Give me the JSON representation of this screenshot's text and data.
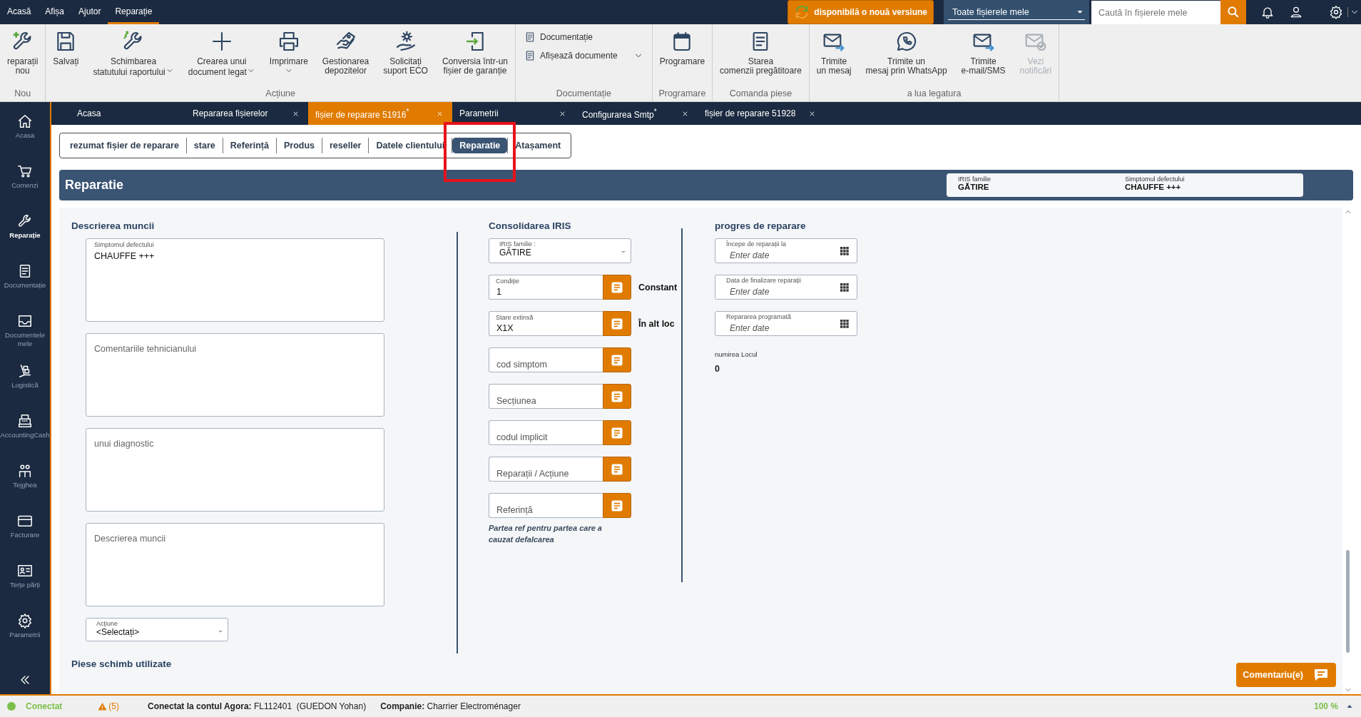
{
  "menu": [
    {
      "label": "Acasă",
      "selected": false
    },
    {
      "label": "Afișa",
      "selected": false
    },
    {
      "label": "Ajutor",
      "selected": false
    },
    {
      "label": "Reparație",
      "selected": true
    }
  ],
  "update_button": {
    "label": "disponibilă o nouă versiune"
  },
  "file_filter": {
    "value": "Toate fișierele mele"
  },
  "search": {
    "placeholder": "Caută în fișierele mele"
  },
  "ribbon": {
    "groups": [
      {
        "label": "Nou",
        "items": [
          {
            "kind": "large",
            "lines": [
              "reparații",
              "nou"
            ],
            "dropdown": false,
            "disabled": false
          }
        ]
      },
      {
        "label": "Acțiune",
        "items": [
          {
            "kind": "large",
            "lines": [
              "Salvați"
            ],
            "dropdown": false,
            "disabled": false
          },
          {
            "kind": "large",
            "lines": [
              "Schimbarea",
              "statutului raportului"
            ],
            "dropdown": true,
            "disabled": false
          },
          {
            "kind": "large",
            "lines": [
              "Crearea unui",
              "document legat"
            ],
            "dropdown": true,
            "disabled": false
          },
          {
            "kind": "large",
            "lines": [
              "Imprimare"
            ],
            "dropdown": true,
            "disabled": false
          },
          {
            "kind": "large",
            "lines": [
              "Gestionarea",
              "depozitelor"
            ],
            "dropdown": false,
            "disabled": false
          },
          {
            "kind": "large",
            "lines": [
              "Solicitați",
              "suport ECO"
            ],
            "dropdown": false,
            "disabled": false
          },
          {
            "kind": "large",
            "lines": [
              "Conversia într-un",
              "fișier de garanție"
            ],
            "dropdown": false,
            "disabled": false
          }
        ]
      },
      {
        "label": "Documentație",
        "items": [
          {
            "kind": "small",
            "lines": [
              "Documentație"
            ],
            "dropdown": false,
            "disabled": false
          },
          {
            "kind": "small",
            "lines": [
              "Afișează documente"
            ],
            "dropdown": true,
            "disabled": false
          }
        ]
      },
      {
        "label": "Programare",
        "items": [
          {
            "kind": "large",
            "lines": [
              "Programare"
            ],
            "dropdown": false,
            "disabled": false
          }
        ]
      },
      {
        "label": "Comanda piese",
        "items": [
          {
            "kind": "large",
            "lines": [
              "Starea",
              "comenzii pregătitoare"
            ],
            "dropdown": false,
            "disabled": false
          }
        ]
      },
      {
        "label": "a lua legatura",
        "items": [
          {
            "kind": "large",
            "lines": [
              "Trimite",
              "un mesaj"
            ],
            "dropdown": false,
            "disabled": false
          },
          {
            "kind": "large",
            "lines": [
              "Trimite un",
              "mesaj prin WhatsApp"
            ],
            "dropdown": false,
            "disabled": false
          },
          {
            "kind": "large",
            "lines": [
              "Trimite",
              "e-mail/SMS"
            ],
            "dropdown": false,
            "disabled": false
          },
          {
            "kind": "large",
            "lines": [
              "Vezi",
              "notificări"
            ],
            "dropdown": false,
            "disabled": true
          }
        ]
      }
    ]
  },
  "sidebar": {
    "items": [
      {
        "lines": [
          "Acasa"
        ],
        "selected": false
      },
      {
        "lines": [
          "Comenzi"
        ],
        "selected": false
      },
      {
        "lines": [
          "Reparație"
        ],
        "selected": true
      },
      {
        "lines": [
          "Documentație"
        ],
        "selected": false
      },
      {
        "lines": [
          "Documentele",
          "mele"
        ],
        "selected": false
      },
      {
        "lines": [
          "Logistică"
        ],
        "selected": false
      },
      {
        "lines": [
          "AccountingCash"
        ],
        "selected": false
      },
      {
        "lines": [
          "Tejghea"
        ],
        "selected": false
      },
      {
        "lines": [
          "Facturare"
        ],
        "selected": false
      },
      {
        "lines": [
          "Terțe părți"
        ],
        "selected": false
      },
      {
        "lines": [
          "Parametrii"
        ],
        "selected": false
      }
    ]
  },
  "tabs": [
    {
      "label": "Acasa",
      "selected": false,
      "closable": false
    },
    {
      "label": "Repararea fișierelor",
      "selected": false,
      "closable": true
    },
    {
      "label": "fișier de reparare 51916$^{*}$",
      "selected": true,
      "closable": true
    },
    {
      "label": "Parametrii",
      "selected": false,
      "closable": true
    },
    {
      "label": "Configurarea Smtp$^{*}$",
      "selected": false,
      "closable": true
    },
    {
      "label": "fișier de reparare 51928",
      "selected": false,
      "closable": true
    }
  ],
  "subtabs": [
    {
      "label": "rezumat fișier de reparare",
      "selected": false,
      "highlighted": false
    },
    {
      "label": "stare",
      "selected": false,
      "highlighted": false
    },
    {
      "label": "Referință",
      "selected": false,
      "highlighted": false
    },
    {
      "label": "Produs",
      "selected": false,
      "highlighted": false
    },
    {
      "label": "reseller",
      "selected": false,
      "highlighted": false
    },
    {
      "label": "Datele clientului",
      "selected": false,
      "highlighted": false
    },
    {
      "label": "Reparatie",
      "selected": true,
      "highlighted": true
    },
    {
      "label": "Atașament",
      "selected": false,
      "highlighted": false
    }
  ],
  "header": {
    "title": "Reparatie",
    "info": [
      {
        "label": "IRIS familie",
        "value": "GĂTIRE"
      },
      {
        "label": "Simptomul defectului",
        "value": "CHAUFFE +++"
      }
    ]
  },
  "work": {
    "heading": "Descrierea muncii",
    "textareas": [
      {
        "label": "Simptomul defectului",
        "value": "CHAUFFE +++"
      },
      {
        "placeholder": "Comentariile tehnicianului"
      },
      {
        "placeholder": "unui diagnostic"
      },
      {
        "placeholder": "Descrierea muncii"
      }
    ],
    "action_select": {
      "label": "Acțiune",
      "value": "<Selectați>"
    },
    "parts_heading": "Piese schimb utilizate"
  },
  "iris": {
    "heading": "Consolidarea IRIS",
    "family_select": {
      "label": "IRIS familie :",
      "value": "GĂTIRE"
    },
    "lookups": [
      {
        "label": "Condiție",
        "value": "1",
        "note": "Constant"
      },
      {
        "label": "Stare extinsă",
        "value": "X1X",
        "note": "În alt loc"
      },
      {
        "placeholder": "cod simptom"
      },
      {
        "placeholder": "Secțiunea"
      },
      {
        "placeholder": "codul implicit"
      },
      {
        "placeholder": "Reparații / Acțiune"
      },
      {
        "placeholder": "Referință"
      }
    ],
    "note": "Partea ref pentru partea care a cauzat defalcarea"
  },
  "progress": {
    "heading": "progres de reparare",
    "dates": [
      {
        "label": "Începe de reparații la",
        "placeholder": "Enter date"
      },
      {
        "label": "Data de finalizare reparații",
        "placeholder": "Enter date"
      },
      {
        "label": "Repararea programată",
        "placeholder": "Enter date"
      }
    ],
    "location": {
      "label": "numirea Locul",
      "value": "0"
    }
  },
  "comment_button": {
    "label": "Comentariu(e)"
  },
  "status_bar": {
    "connected": true,
    "connection": "Conectat",
    "warnings": "(5)",
    "account": "**Conectat la contul Agora:** FL112401  (GUEDON Yohan)",
    "company": "**Companie:** Charrier Electroménager",
    "zoom": "100 %"
  }
}
